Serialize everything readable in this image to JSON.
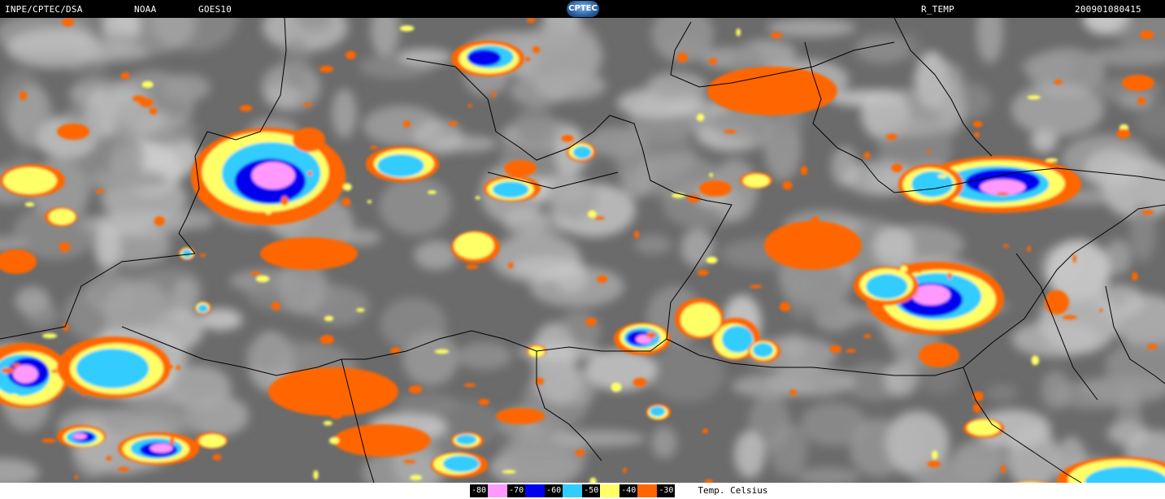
{
  "header": {
    "source": "INPE/CPTEC/DSA",
    "agency": "NOAA",
    "satellite": "GOES10",
    "logo_text": "CPTEC",
    "product": "R_TEMP",
    "timestamp": "200901080415"
  },
  "legend": {
    "title": "Temp. Celsius",
    "entries": [
      {
        "label": "-80",
        "color": "#ff99ff"
      },
      {
        "label": "-70",
        "color": "#0000ee"
      },
      {
        "label": "-60",
        "color": "#33ccff"
      },
      {
        "label": "-50",
        "color": "#ffff66"
      },
      {
        "label": "-40",
        "color": "#ff6600"
      },
      {
        "label": "-30",
        "color": "#ffffff"
      }
    ]
  },
  "map": {
    "background_color": "#6b6b6b",
    "cloud_color": "#c8c8c8",
    "border_color": "#000000"
  }
}
